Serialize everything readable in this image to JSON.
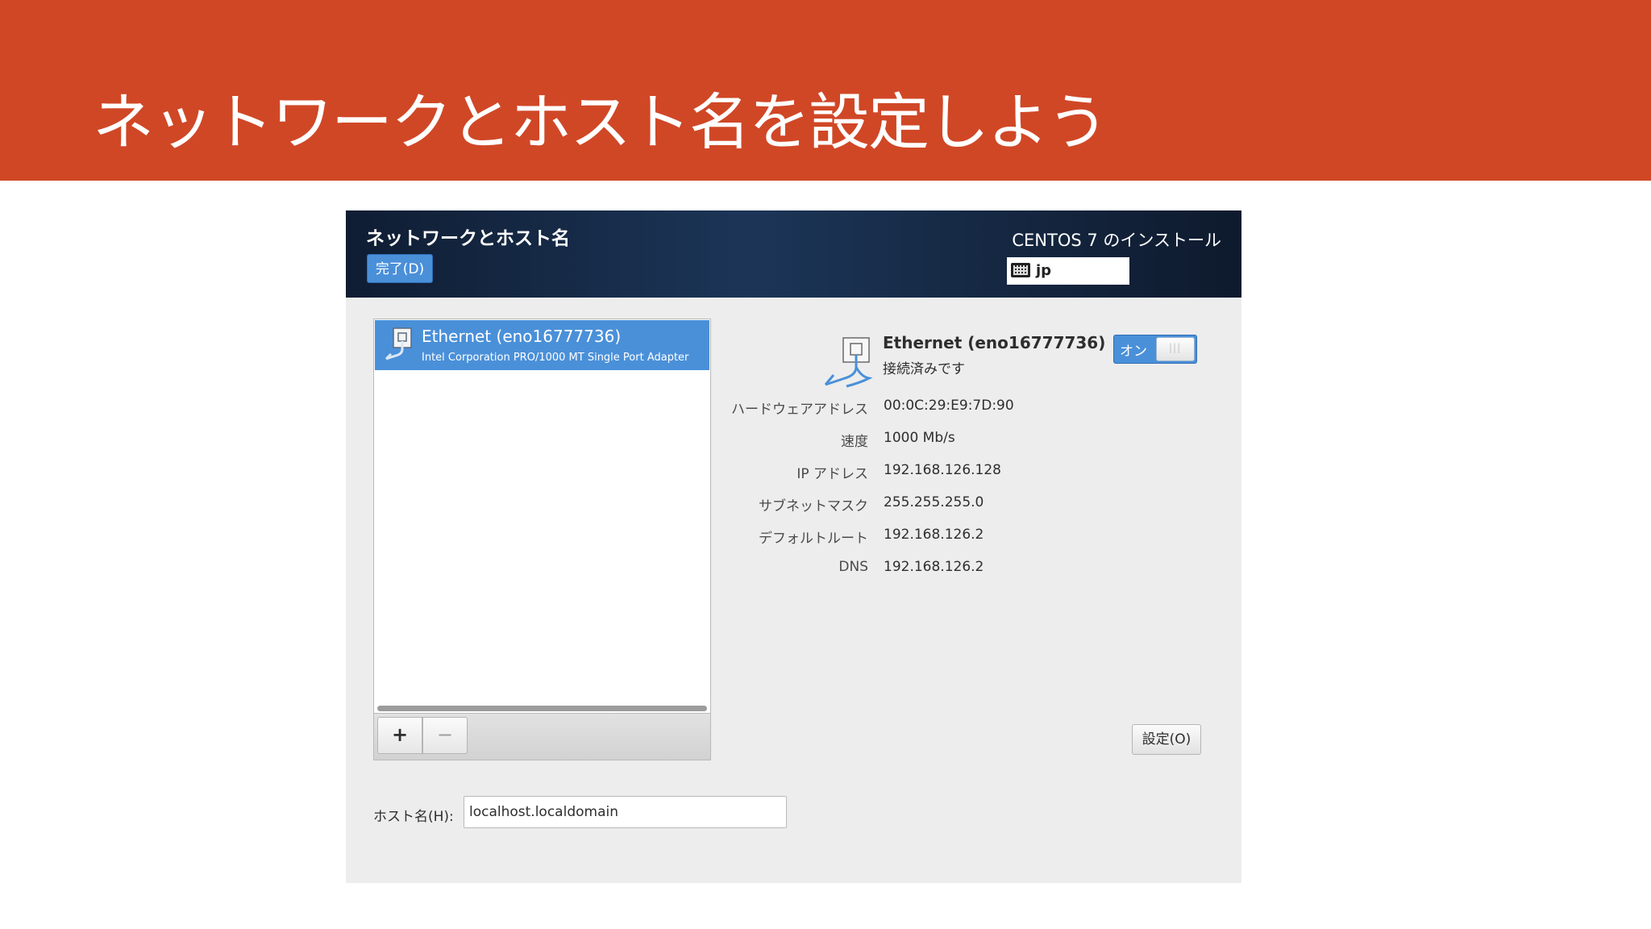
{
  "slide": {
    "title": "ネットワークとホスト名を設定しよう",
    "header_color": "#d04726"
  },
  "installer": {
    "screen_title": "ネットワークとホスト名",
    "done_button": "完了(D)",
    "product": "CENTOS 7 のインストール",
    "keyboard_layout": "jp",
    "keyboard_icon": "keyboard-icon",
    "accent_color": "#4a90d9"
  },
  "devices": [
    {
      "name": "Ethernet (eno16777736)",
      "description": "Intel Corporation PRO/1000 MT Single Port Adapter",
      "icon": "ethernet-cable-icon",
      "selected": true
    }
  ],
  "list_toolbar": {
    "add": "+",
    "remove": "−"
  },
  "details": {
    "name": "Ethernet (eno16777736)",
    "status": "接続済みです",
    "switch_label": "オン",
    "switch_on": true,
    "properties": [
      {
        "label": "ハードウェアアドレス",
        "value": "00:0C:29:E9:7D:90"
      },
      {
        "label": "速度",
        "value": "1000 Mb/s"
      },
      {
        "label": "IP アドレス",
        "value": "192.168.126.128"
      },
      {
        "label": "サブネットマスク",
        "value": "255.255.255.0"
      },
      {
        "label": "デフォルトルート",
        "value": "192.168.126.2"
      },
      {
        "label": "DNS",
        "value": "192.168.126.2"
      }
    ],
    "config_button": "設定(O)"
  },
  "hostname": {
    "label": "ホスト名(H):",
    "value": "localhost.localdomain"
  }
}
